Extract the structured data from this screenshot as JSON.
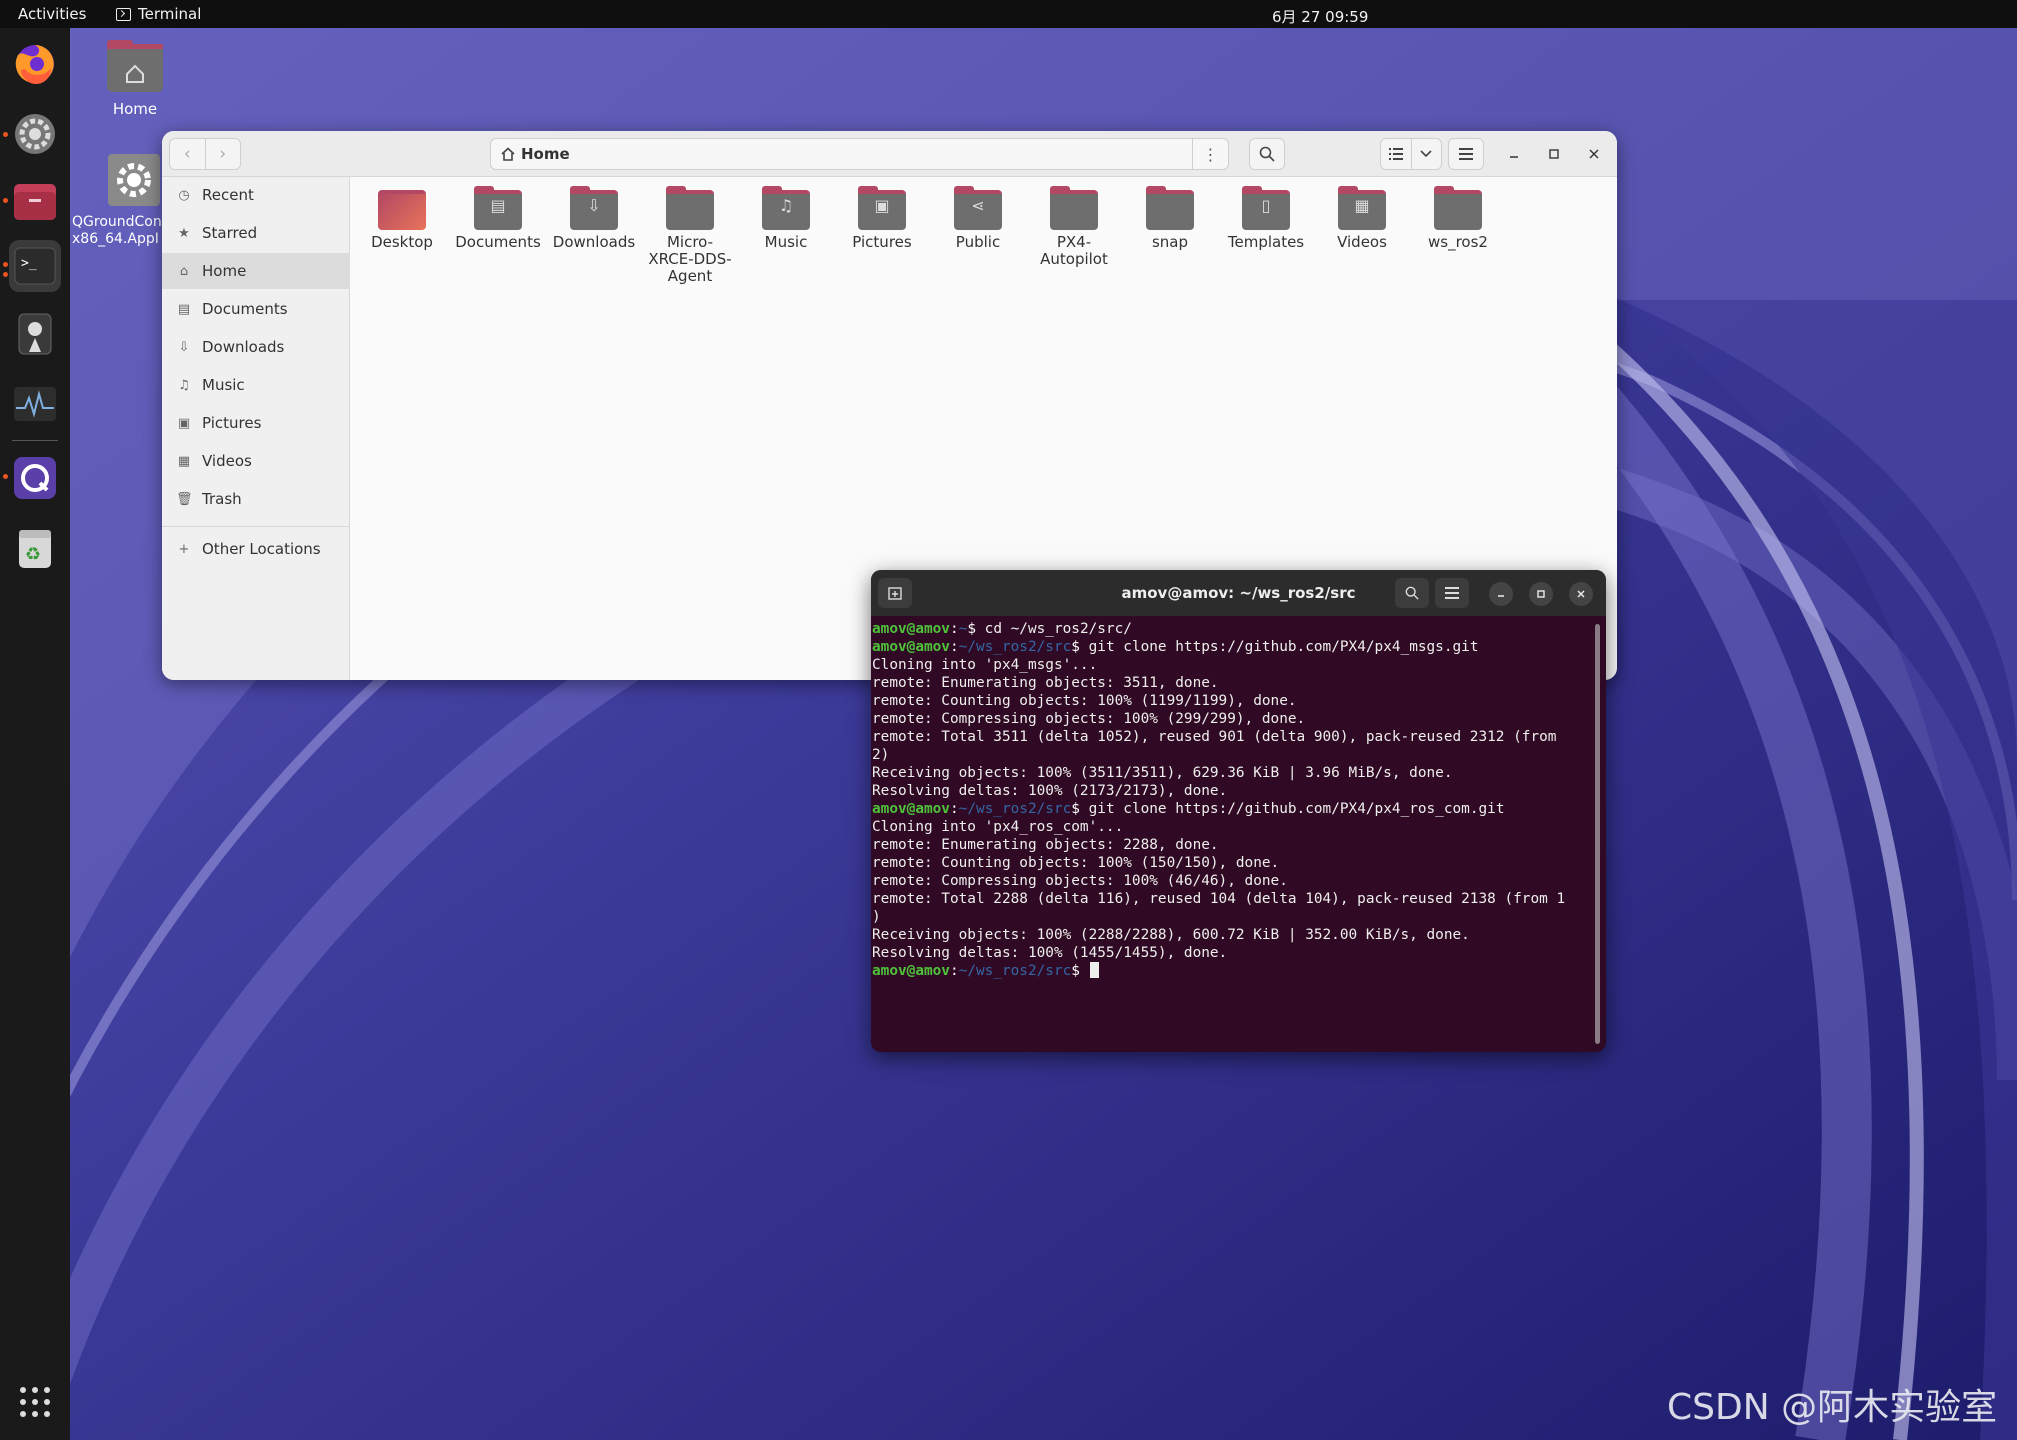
{
  "topbar": {
    "activities": "Activities",
    "app_name": "Terminal",
    "clock": "6月 27  09:59"
  },
  "dock": {
    "apps": [
      "firefox-icon",
      "settings-icon",
      "files-icon",
      "terminal-icon",
      "cheese-icon",
      "system-monitor-icon",
      "qgroundcontrol-icon",
      "trash-icon",
      "show-apps-icon"
    ]
  },
  "desktop": {
    "home_label": "Home",
    "appimage_label_line1": "QGroundCon",
    "appimage_label_line2": "x86_64.AppI"
  },
  "files": {
    "path": "Home",
    "sidebar": [
      {
        "label": "Recent",
        "icon": "clock-icon"
      },
      {
        "label": "Starred",
        "icon": "star-icon"
      },
      {
        "label": "Home",
        "icon": "home-icon"
      },
      {
        "label": "Documents",
        "icon": "document-icon"
      },
      {
        "label": "Downloads",
        "icon": "download-icon"
      },
      {
        "label": "Music",
        "icon": "music-icon"
      },
      {
        "label": "Pictures",
        "icon": "picture-icon"
      },
      {
        "label": "Videos",
        "icon": "video-icon"
      },
      {
        "label": "Trash",
        "icon": "trash-icon"
      }
    ],
    "other_locations": "Other Locations",
    "folders": [
      {
        "label": "Desktop"
      },
      {
        "label": "Documents"
      },
      {
        "label": "Downloads"
      },
      {
        "label": "Micro-\nXRCE-DDS-\nAgent"
      },
      {
        "label": "Music"
      },
      {
        "label": "Pictures"
      },
      {
        "label": "Public"
      },
      {
        "label": "PX4-\nAutopilot"
      },
      {
        "label": "snap"
      },
      {
        "label": "Templates"
      },
      {
        "label": "Videos"
      },
      {
        "label": "ws_ros2"
      }
    ]
  },
  "terminal": {
    "title": "amov@amov: ~/ws_ros2/src",
    "user": "amov@amov",
    "lines": [
      {
        "type": "prompt",
        "path": "~",
        "cmd": "cd ~/ws_ros2/src/"
      },
      {
        "type": "prompt",
        "path": "~/ws_ros2/src",
        "cmd": "git clone https://github.com/PX4/px4_msgs.git"
      },
      {
        "type": "out",
        "text": "Cloning into 'px4_msgs'..."
      },
      {
        "type": "out",
        "text": "remote: Enumerating objects: 3511, done."
      },
      {
        "type": "out",
        "text": "remote: Counting objects: 100% (1199/1199), done."
      },
      {
        "type": "out",
        "text": "remote: Compressing objects: 100% (299/299), done."
      },
      {
        "type": "out",
        "text": "remote: Total 3511 (delta 1052), reused 901 (delta 900), pack-reused 2312 (from"
      },
      {
        "type": "out",
        "text": "2)"
      },
      {
        "type": "out",
        "text": "Receiving objects: 100% (3511/3511), 629.36 KiB | 3.96 MiB/s, done."
      },
      {
        "type": "out",
        "text": "Resolving deltas: 100% (2173/2173), done."
      },
      {
        "type": "prompt",
        "path": "~/ws_ros2/src",
        "cmd": "git clone https://github.com/PX4/px4_ros_com.git"
      },
      {
        "type": "out",
        "text": "Cloning into 'px4_ros_com'..."
      },
      {
        "type": "out",
        "text": "remote: Enumerating objects: 2288, done."
      },
      {
        "type": "out",
        "text": "remote: Counting objects: 100% (150/150), done."
      },
      {
        "type": "out",
        "text": "remote: Compressing objects: 100% (46/46), done."
      },
      {
        "type": "out",
        "text": "remote: Total 2288 (delta 116), reused 104 (delta 104), pack-reused 2138 (from 1"
      },
      {
        "type": "out",
        "text": ")"
      },
      {
        "type": "out",
        "text": "Receiving objects: 100% (2288/2288), 600.72 KiB | 352.00 KiB/s, done."
      },
      {
        "type": "out",
        "text": "Resolving deltas: 100% (1455/1455), done."
      },
      {
        "type": "prompt",
        "path": "~/ws_ros2/src",
        "cmd": ""
      }
    ]
  },
  "watermark": "CSDN @阿木实验室",
  "colors": {
    "accent": "#e95420",
    "terminal_bg": "#300a24",
    "prompt_user": "#4ec23a",
    "prompt_path": "#3465a4",
    "folder_tab": "#b24863"
  }
}
